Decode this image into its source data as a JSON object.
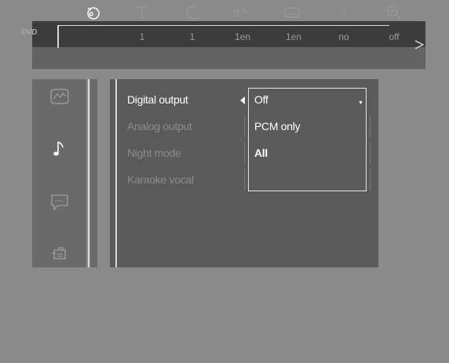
{
  "osd": {
    "icons": [
      "angle-icon",
      "title-icon",
      "chapter-icon",
      "audio-icon",
      "subtitle-icon",
      "repeat-icon",
      "zoom-icon"
    ],
    "disc_logo": "DVD",
    "values": [
      "1",
      "1",
      "1en",
      "1en",
      "no",
      "off"
    ]
  },
  "sidebar": {
    "items": [
      "video-setup-icon",
      "audio-setup-icon",
      "language-setup-icon",
      "features-setup-icon"
    ]
  },
  "menu": {
    "options": [
      "Digital output",
      "Analog output",
      "Night mode",
      "Karaoke vocal"
    ]
  },
  "dropdown": {
    "selected": "Off",
    "items": [
      "PCM only",
      "All"
    ]
  }
}
